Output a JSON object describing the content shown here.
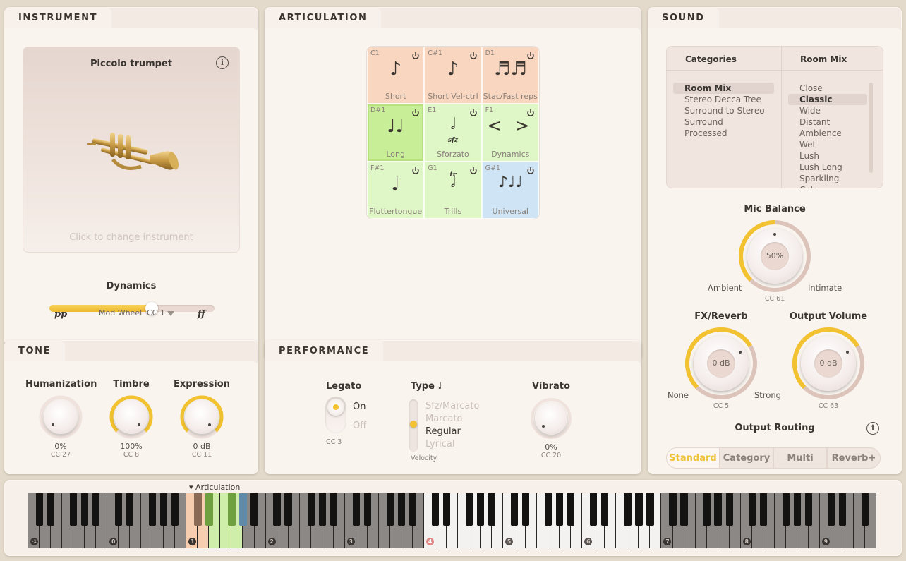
{
  "instrument": {
    "tab": "INSTRUMENT",
    "name": "Piccolo trumpet",
    "hint": "Click to change instrument",
    "dynamics": {
      "title": "Dynamics",
      "value": 0.62,
      "low": "pp",
      "high": "ff",
      "source_label": "Mod Wheel",
      "cc": "CC 1"
    }
  },
  "tone": {
    "tab": "TONE",
    "knobs": [
      {
        "title": "Humanization",
        "value": "0%",
        "cc": "CC 27",
        "level": 0.0
      },
      {
        "title": "Timbre",
        "value": "100%",
        "cc": "CC 8",
        "level": 1.0
      },
      {
        "title": "Expression",
        "value": "0 dB",
        "cc": "CC 11",
        "level": 1.0
      }
    ]
  },
  "articulation": {
    "tab": "ARTICULATION",
    "cells": [
      {
        "key": "C1",
        "name": "Short",
        "glyph": "♪",
        "color": "#f9d6bf"
      },
      {
        "key": "C#1",
        "name": "Short Vel-ctrl",
        "glyph": "♪",
        "color": "#f9d6bf"
      },
      {
        "key": "D1",
        "name": "Stac/Fast reps",
        "glyph": "♬♬",
        "color": "#f9d6bf"
      },
      {
        "key": "D#1",
        "name": "Long",
        "glyph": "♩♩",
        "color": "#c9ee98"
      },
      {
        "key": "E1",
        "name": "Sforzato",
        "glyph": "𝅗𝅥",
        "color": "#dff6c6"
      },
      {
        "key": "F1",
        "name": "Dynamics",
        "glyph": "< >",
        "color": "#dff6c6"
      },
      {
        "key": "F#1",
        "name": "Fluttertongue",
        "glyph": "♩",
        "color": "#dff6c6"
      },
      {
        "key": "G1",
        "name": "Trills",
        "glyph": "𝅗𝅥",
        "color": "#dff6c6"
      },
      {
        "key": "G#1",
        "name": "Universal",
        "glyph": "♪♩♩",
        "color": "#cfe5f6"
      }
    ],
    "sfz": "sfz",
    "tr": "tr"
  },
  "performance": {
    "tab": "PERFORMANCE",
    "legato": {
      "title": "Legato",
      "on": "On",
      "off": "Off",
      "cc": "CC 3"
    },
    "type": {
      "title": "Type",
      "options": [
        "Sfz/Marcato",
        "Marcato",
        "Regular",
        "Lyrical"
      ],
      "selected": "Regular",
      "footer": "Velocity"
    },
    "vibrato": {
      "title": "Vibrato",
      "value": "0%",
      "cc": "CC 20",
      "level": 0.0
    }
  },
  "sound": {
    "tab": "SOUND",
    "categories_header": "Categories",
    "categories": [
      "Room Mix",
      "Stereo Decca Tree",
      "Surround to Stereo",
      "Surround",
      "Processed"
    ],
    "selected_category": "Room Mix",
    "roommix_header": "Room Mix",
    "roommix": [
      "Close",
      "Classic",
      "Wide",
      "Distant",
      "Ambience",
      "Wet",
      "Lush",
      "Lush Long",
      "Sparkling",
      "Cat..."
    ],
    "selected_roommix": "Classic",
    "mic_balance": {
      "title": "Mic Balance",
      "value": "50%",
      "left": "Ambient",
      "right": "Intimate",
      "cc": "CC 61",
      "level": 0.5
    },
    "fx_reverb": {
      "title": "FX/Reverb",
      "value": "0 dB",
      "left": "None",
      "right": "Strong",
      "cc": "CC 5",
      "level": 0.72
    },
    "output_volume": {
      "title": "Output Volume",
      "value": "0 dB",
      "cc": "CC 63",
      "level": 0.72
    },
    "routing": {
      "title": "Output Routing",
      "options": [
        "Standard",
        "Category",
        "Multi",
        "Reverb+"
      ],
      "selected": "Standard"
    }
  },
  "keyboard": {
    "articulation_label": "▾ Articulation",
    "octaves": [
      "-1",
      "0",
      "1",
      "2",
      "3",
      "4",
      "5",
      "6",
      "7",
      "8",
      "9"
    ],
    "colors": {
      "accent": "#f2c230",
      "inactive_key": "#8c8886",
      "playable_key": "#f4f2f0"
    }
  }
}
